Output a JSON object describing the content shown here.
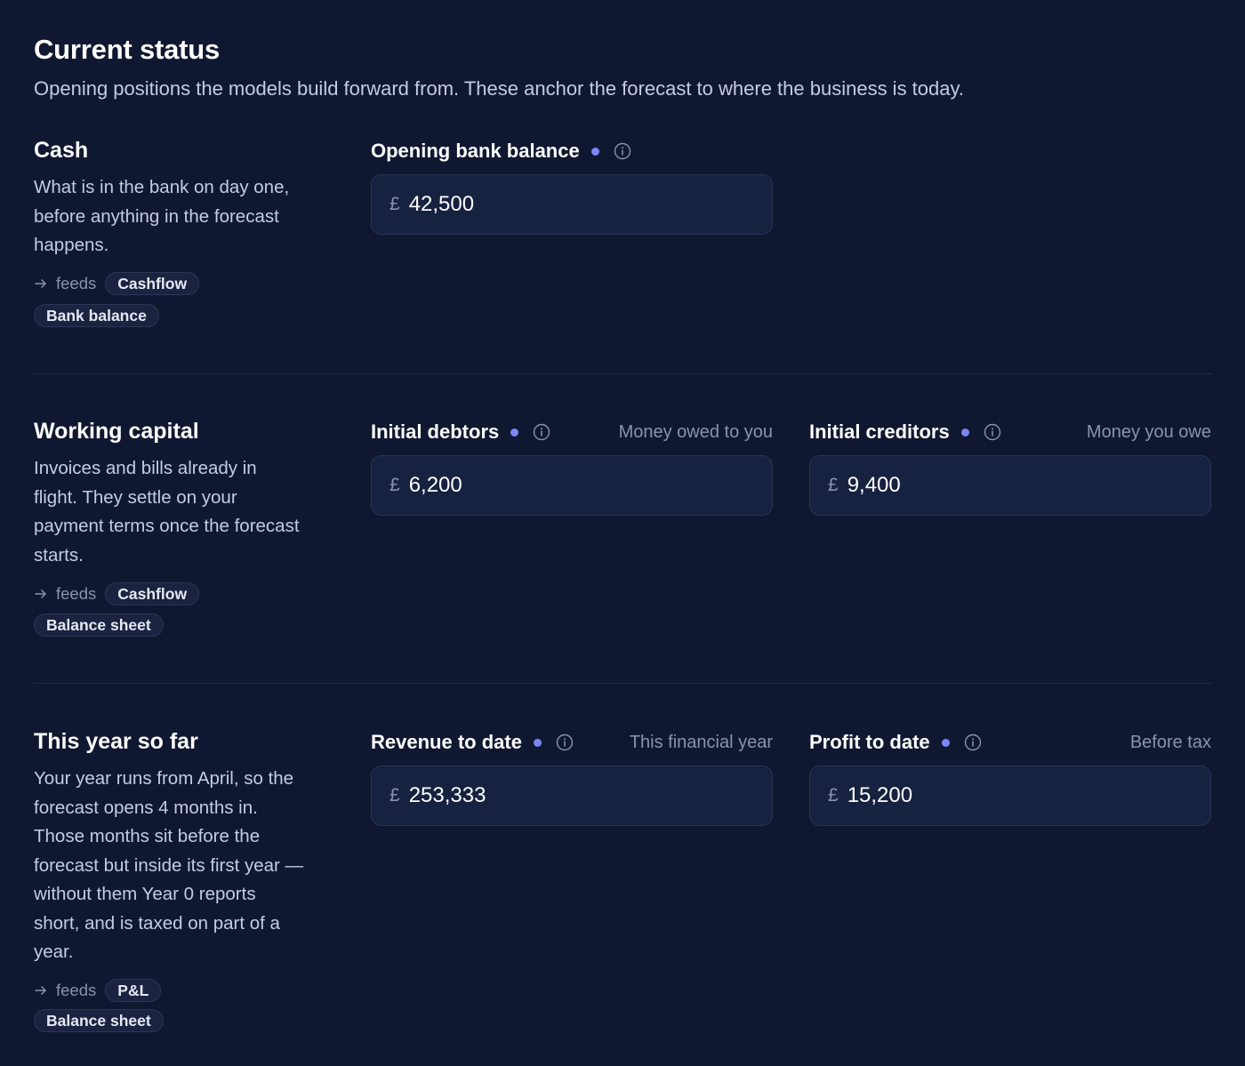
{
  "header": {
    "title": "Current status",
    "subtitle": "Opening positions the models build forward from. These anchor the forecast to where the business is today."
  },
  "feeds_label": "feeds",
  "sections": [
    {
      "title": "Cash",
      "description": "What is in the bank on day one, before anything in the forecast happens.",
      "feeds": [
        "Cashflow",
        "Bank balance"
      ],
      "fields": [
        {
          "label": "Opening bank balance",
          "hint": "",
          "currency": "£",
          "value": "42,500"
        }
      ]
    },
    {
      "title": "Working capital",
      "description": "Invoices and bills already in flight. They settle on your payment terms once the forecast starts.",
      "feeds": [
        "Cashflow",
        "Balance sheet"
      ],
      "fields": [
        {
          "label": "Initial debtors",
          "hint": "Money owed to you",
          "currency": "£",
          "value": "6,200"
        },
        {
          "label": "Initial creditors",
          "hint": "Money you owe",
          "currency": "£",
          "value": "9,400"
        }
      ]
    },
    {
      "title": "This year so far",
      "description": "Your year runs from April, so the forecast opens 4 months in. Those months sit before the forecast but inside its first year — without them Year 0 reports short, and is taxed on part of a year.",
      "feeds": [
        "P&L",
        "Balance sheet"
      ],
      "fields": [
        {
          "label": "Revenue to date",
          "hint": "This financial year",
          "currency": "£",
          "value": "253,333"
        },
        {
          "label": "Profit to date",
          "hint": "Before tax",
          "currency": "£",
          "value": "15,200"
        }
      ]
    }
  ],
  "colors": {
    "background": "#101831",
    "input_background": "#172140",
    "accent_dot": "#7e86f6",
    "muted_text": "#8a92ad"
  }
}
